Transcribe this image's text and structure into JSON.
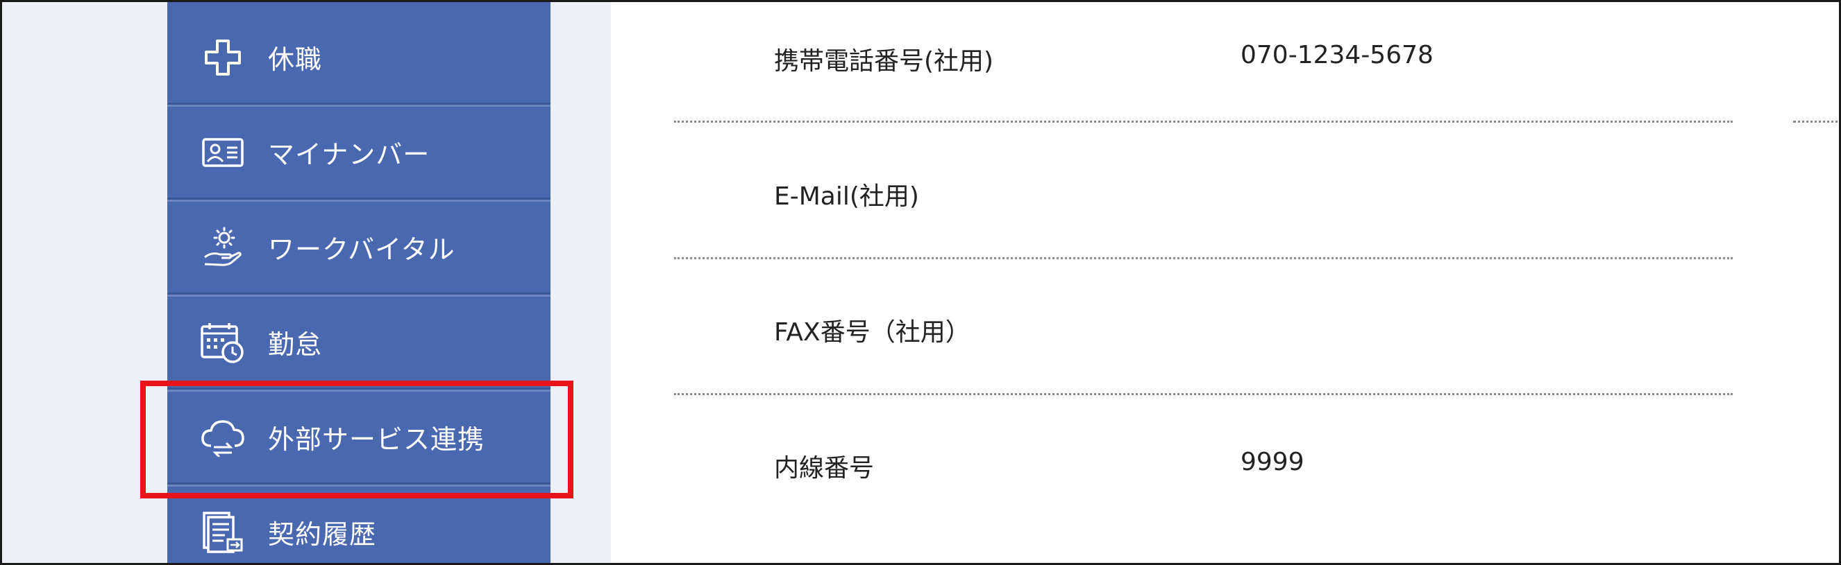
{
  "sidebar": {
    "items": [
      {
        "label": "休職",
        "icon": "plus-cross-icon"
      },
      {
        "label": "マイナンバー",
        "icon": "id-card-icon"
      },
      {
        "label": "ワークバイタル",
        "icon": "hand-sun-icon"
      },
      {
        "label": "勤怠",
        "icon": "calendar-clock-icon"
      },
      {
        "label": "外部サービス連携",
        "icon": "cloud-sync-icon"
      },
      {
        "label": "契約履歴",
        "icon": "document-history-icon"
      }
    ],
    "highlighted_item": "外部サービス連携",
    "colors": {
      "background": "#4a68b0",
      "text": "#ffffff",
      "highlight_border": "#e8141c"
    }
  },
  "details": {
    "rows": [
      {
        "label": "携帯電話番号(社用)",
        "value": "070-1234-5678"
      },
      {
        "label": "E-Mail(社用)",
        "value": ""
      },
      {
        "label": "FAX番号（社用）",
        "value": ""
      },
      {
        "label": "内線番号",
        "value": "9999"
      }
    ]
  }
}
